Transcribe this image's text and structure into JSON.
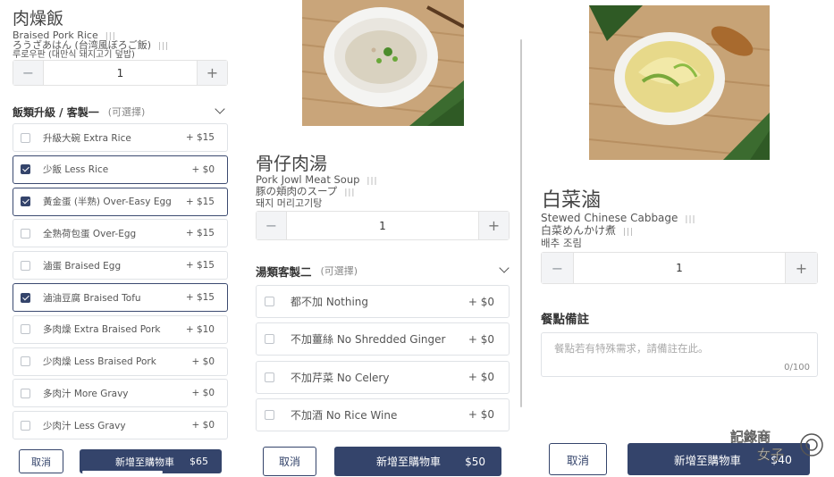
{
  "panel1": {
    "title": "肉燥飯",
    "name_en": "Braised Pork Rice",
    "name_ja": "ろうざあはん (台湾風ぼろご飯)",
    "name_ko": "루로우판 (대만식 돼지고기 덮밥)",
    "qty": "1",
    "group_title": "飯類升級 / 客製一",
    "group_optional": "(可選擇)",
    "options": [
      {
        "label": "升級大碗 Extra Rice",
        "price": "+ $15",
        "checked": false
      },
      {
        "label": "少飯 Less Rice",
        "price": "+ $0",
        "checked": true
      },
      {
        "label": "黃金蛋 (半熟) Over-Easy Egg",
        "price": "+ $15",
        "checked": true
      },
      {
        "label": "全熟荷包蛋 Over-Egg",
        "price": "+ $15",
        "checked": false
      },
      {
        "label": "滷蛋 Braised Egg",
        "price": "+ $15",
        "checked": false
      },
      {
        "label": "滷油豆腐 Braised Tofu",
        "price": "+ $15",
        "checked": true
      },
      {
        "label": "多肉燥 Extra Braised Pork",
        "price": "+ $10",
        "checked": false
      },
      {
        "label": "少肉燥 Less Braised Pork",
        "price": "+ $0",
        "checked": false
      },
      {
        "label": "多肉汁 More Gravy",
        "price": "+ $0",
        "checked": false
      },
      {
        "label": "少肉汁 Less Gravy",
        "price": "+ $0",
        "checked": false
      }
    ],
    "cancel": "取消",
    "add": "新增至購物車",
    "total": "$65"
  },
  "panel2": {
    "title": "骨仔肉湯",
    "name_en": "Pork Jowl Meat Soup",
    "name_ja": "豚の頬肉のスープ",
    "name_ko": "돼지 머리고기탕",
    "qty": "1",
    "group_title": "湯類客製二",
    "group_optional": "(可選擇)",
    "options": [
      {
        "label": "都不加 Nothing",
        "price": "+ $0",
        "checked": false
      },
      {
        "label": "不加薑絲 No Shredded Ginger",
        "price": "+ $0",
        "checked": false
      },
      {
        "label": "不加芹菜 No Celery",
        "price": "+ $0",
        "checked": false
      },
      {
        "label": "不加酒 No Rice Wine",
        "price": "+ $0",
        "checked": false
      }
    ],
    "cancel": "取消",
    "add": "新增至購物車",
    "total": "$50"
  },
  "panel3": {
    "title": "白菜滷",
    "name_en": "Stewed Chinese Cabbage",
    "name_ja": "白菜めんかけ煮",
    "name_ko": "배추 조림",
    "qty": "1",
    "notes_title": "餐點備註",
    "notes_placeholder": "餐點若有特殊需求，請備註在此。",
    "notes_count": "0/100",
    "cancel": "取消",
    "add": "新增至購物車",
    "total": "$40"
  },
  "watermark": "記錄商女子",
  "colors": {
    "accent": "#34446b",
    "border": "#dfe2e6"
  }
}
